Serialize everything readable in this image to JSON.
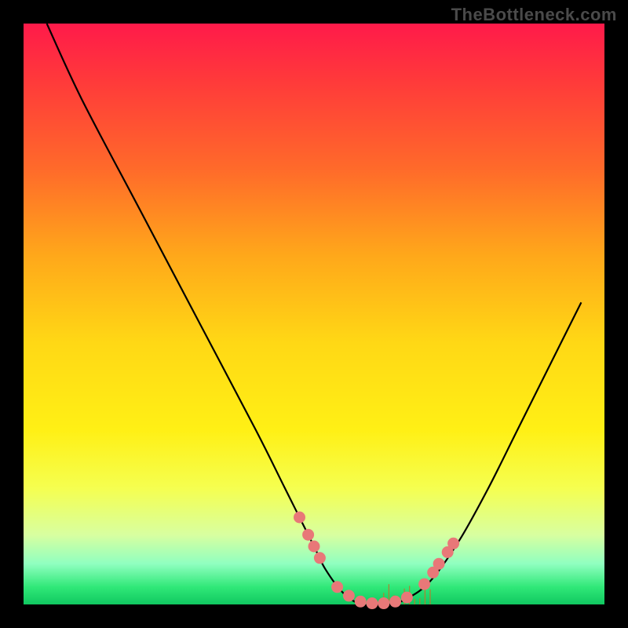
{
  "watermark": "TheBottleneck.com",
  "chart_data": {
    "type": "line",
    "title": "",
    "xlabel": "",
    "ylabel": "",
    "xlim": [
      0,
      100
    ],
    "ylim": [
      0,
      100
    ],
    "series": [
      {
        "name": "curve",
        "x": [
          4,
          10,
          20,
          30,
          40,
          45,
          50,
          52,
          55,
          58,
          60,
          63,
          66,
          70,
          75,
          80,
          85,
          90,
          96
        ],
        "y": [
          100,
          87,
          68,
          49,
          30,
          20,
          10,
          6,
          2,
          0,
          0,
          0,
          1,
          4,
          11,
          20,
          30,
          40,
          52
        ]
      }
    ],
    "markers": {
      "name": "highlight-points",
      "color": "#e87878",
      "x": [
        47.5,
        49,
        50,
        51,
        54,
        56,
        58,
        60,
        62,
        64,
        66,
        69,
        70.5,
        71.5,
        73,
        74
      ],
      "y": [
        15,
        12,
        10,
        8,
        3,
        1.5,
        0.5,
        0.2,
        0.2,
        0.5,
        1.2,
        3.5,
        5.5,
        7,
        9,
        10.5
      ]
    },
    "noise_ticks": {
      "x_start": 62,
      "x_end": 70,
      "count": 10,
      "max_height": 3
    }
  }
}
